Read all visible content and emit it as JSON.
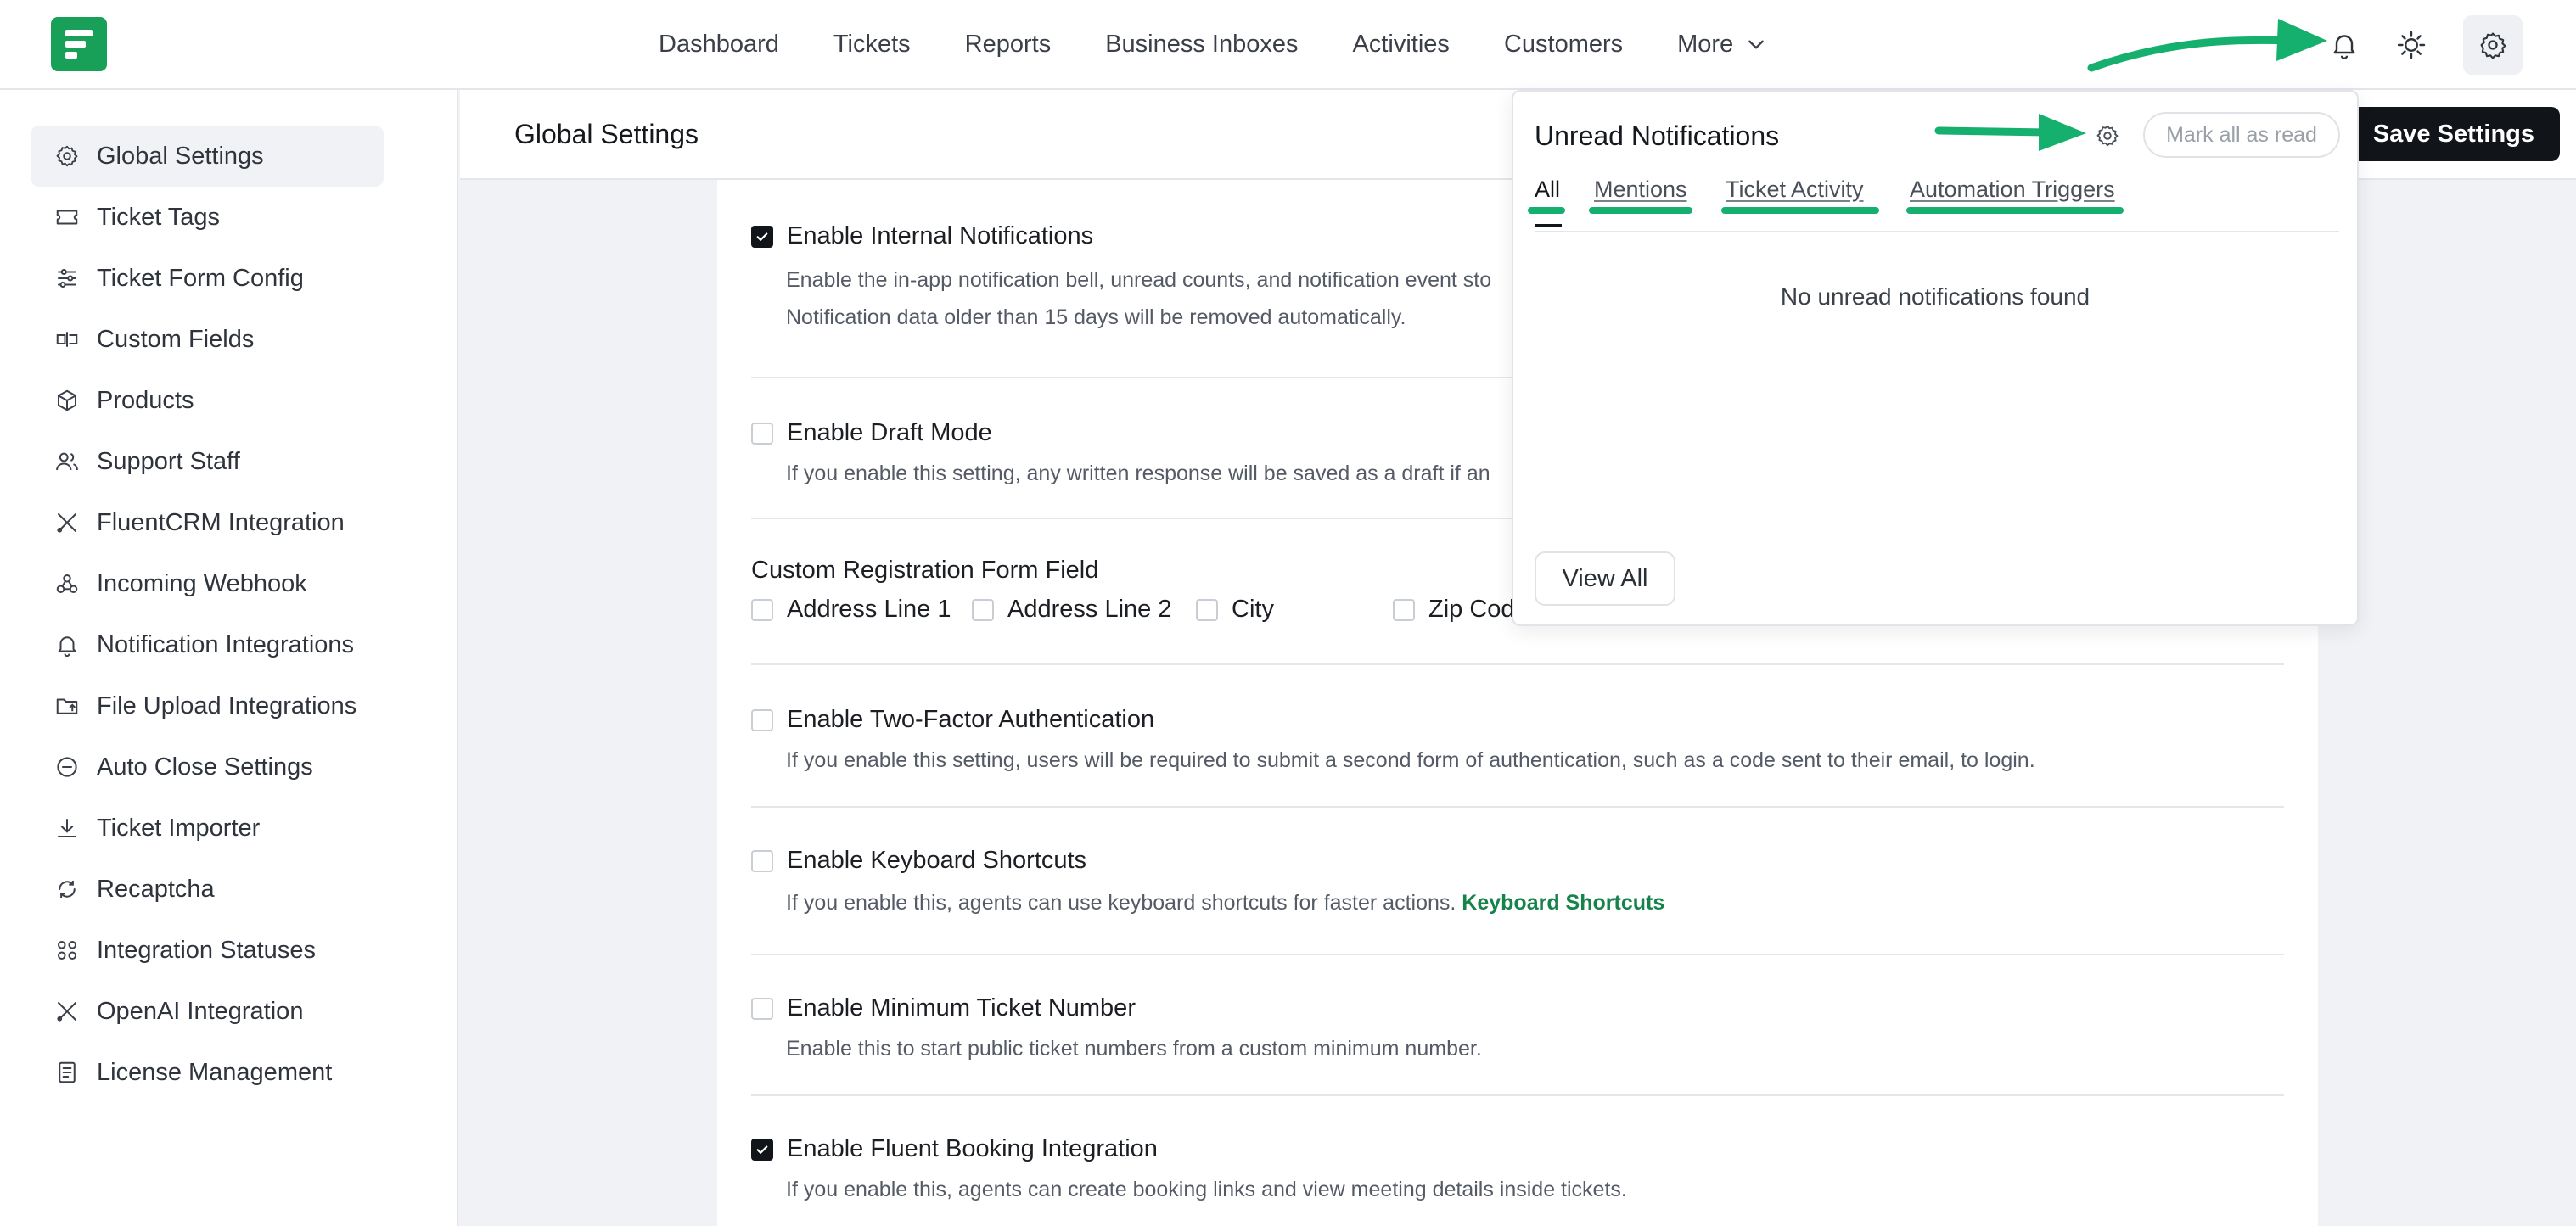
{
  "nav": {
    "items": [
      "Dashboard",
      "Tickets",
      "Reports",
      "Business Inboxes",
      "Activities",
      "Customers"
    ],
    "more_label": "More"
  },
  "sidebar": {
    "items": [
      {
        "label": "Global Settings",
        "icon": "gear-icon",
        "active": true
      },
      {
        "label": "Ticket Tags",
        "icon": "ticket-icon"
      },
      {
        "label": "Ticket Form Config",
        "icon": "sliders-icon"
      },
      {
        "label": "Custom Fields",
        "icon": "custom-field-icon"
      },
      {
        "label": "Products",
        "icon": "box-icon"
      },
      {
        "label": "Support Staff",
        "icon": "users-icon"
      },
      {
        "label": "FluentCRM Integration",
        "icon": "tools-icon"
      },
      {
        "label": "Incoming Webhook",
        "icon": "webhook-icon"
      },
      {
        "label": "Notification Integrations",
        "icon": "bell-icon"
      },
      {
        "label": "File Upload Integrations",
        "icon": "folder-upload-icon"
      },
      {
        "label": "Auto Close Settings",
        "icon": "minus-circle-icon"
      },
      {
        "label": "Ticket Importer",
        "icon": "download-icon"
      },
      {
        "label": "Recaptcha",
        "icon": "refresh-icon"
      },
      {
        "label": "Integration Statuses",
        "icon": "grid-icon"
      },
      {
        "label": "OpenAI Integration",
        "icon": "tools-icon"
      },
      {
        "label": "License Management",
        "icon": "document-icon"
      }
    ]
  },
  "header": {
    "title": "Global Settings",
    "save_label": "Save Settings"
  },
  "settings": {
    "internal_notifications": {
      "label": "Enable Internal Notifications",
      "checked": true,
      "desc_line1": "Enable the in-app notification bell, unread counts, and notification event sto",
      "desc_line2": "Notification data older than 15 days will be removed automatically."
    },
    "draft_mode": {
      "label": "Enable Draft Mode",
      "checked": false,
      "desc": "If you enable this setting, any written response will be saved as a draft if an"
    },
    "registration": {
      "label": "Custom Registration Form Field",
      "options": [
        "Address Line 1",
        "Address Line 2",
        "City",
        "Zip Code"
      ]
    },
    "two_factor": {
      "label": "Enable Two-Factor Authentication",
      "checked": false,
      "desc": "If you enable this setting, users will be required to submit a second form of authentication, such as a code sent to their email, to login."
    },
    "keyboard_shortcuts": {
      "label": "Enable Keyboard Shortcuts",
      "checked": false,
      "desc": "If you enable this, agents can use keyboard shortcuts for faster actions.",
      "link": "Keyboard Shortcuts"
    },
    "min_ticket": {
      "label": "Enable Minimum Ticket Number",
      "checked": false,
      "desc": "Enable this to start public ticket numbers from a custom minimum number."
    },
    "fluent_booking": {
      "label": "Enable Fluent Booking Integration",
      "checked": true,
      "desc": "If you enable this, agents can create booking links and view meeting details inside tickets."
    }
  },
  "notifications": {
    "title": "Unread Notifications",
    "mark_all_label": "Mark all as read",
    "tabs": [
      "All",
      "Mentions",
      "Ticket Activity",
      "Automation Triggers"
    ],
    "active_tab": "All",
    "empty_message": "No unread notifications found",
    "view_all_label": "View All"
  },
  "colors": {
    "brand": "#18a058",
    "annotation": "#16b06e",
    "primary_button": "#111418",
    "link": "#16834b"
  }
}
